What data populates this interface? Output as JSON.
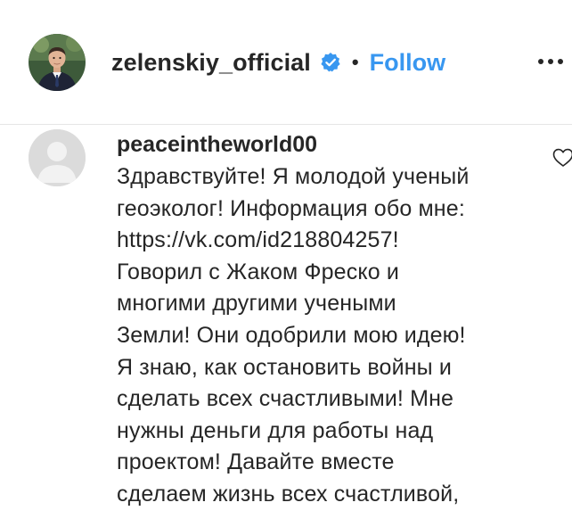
{
  "post_header": {
    "username": "zelenskiy_official",
    "verified_icon": "verified-badge-icon",
    "separator": "•",
    "follow_label": "Follow",
    "more_icon": "more-options-icon"
  },
  "comment": {
    "username": "peaceintheworld00",
    "avatar_icon": "default-avatar-icon",
    "like_icon": "heart-icon",
    "lines": [
      "Здравствуйте! Я молодой ученый",
      "геоэколог! Информация обо мне:",
      "https://vk.com/id218804257!",
      "Говорил с Жаком Фреско и",
      "многими другими учеными",
      "Земли! Они одобрили мою идею!",
      "Я знаю, как остановить войны и",
      "сделать всех счастливыми! Мне",
      "нужны деньги для работы над",
      "проектом! Давайте вместе",
      "сделаем жизнь всех счастливой,"
    ]
  },
  "colors": {
    "accent": "#3897f0",
    "verified": "#3897f0",
    "text": "#262626",
    "divider": "#e6e6e6"
  }
}
